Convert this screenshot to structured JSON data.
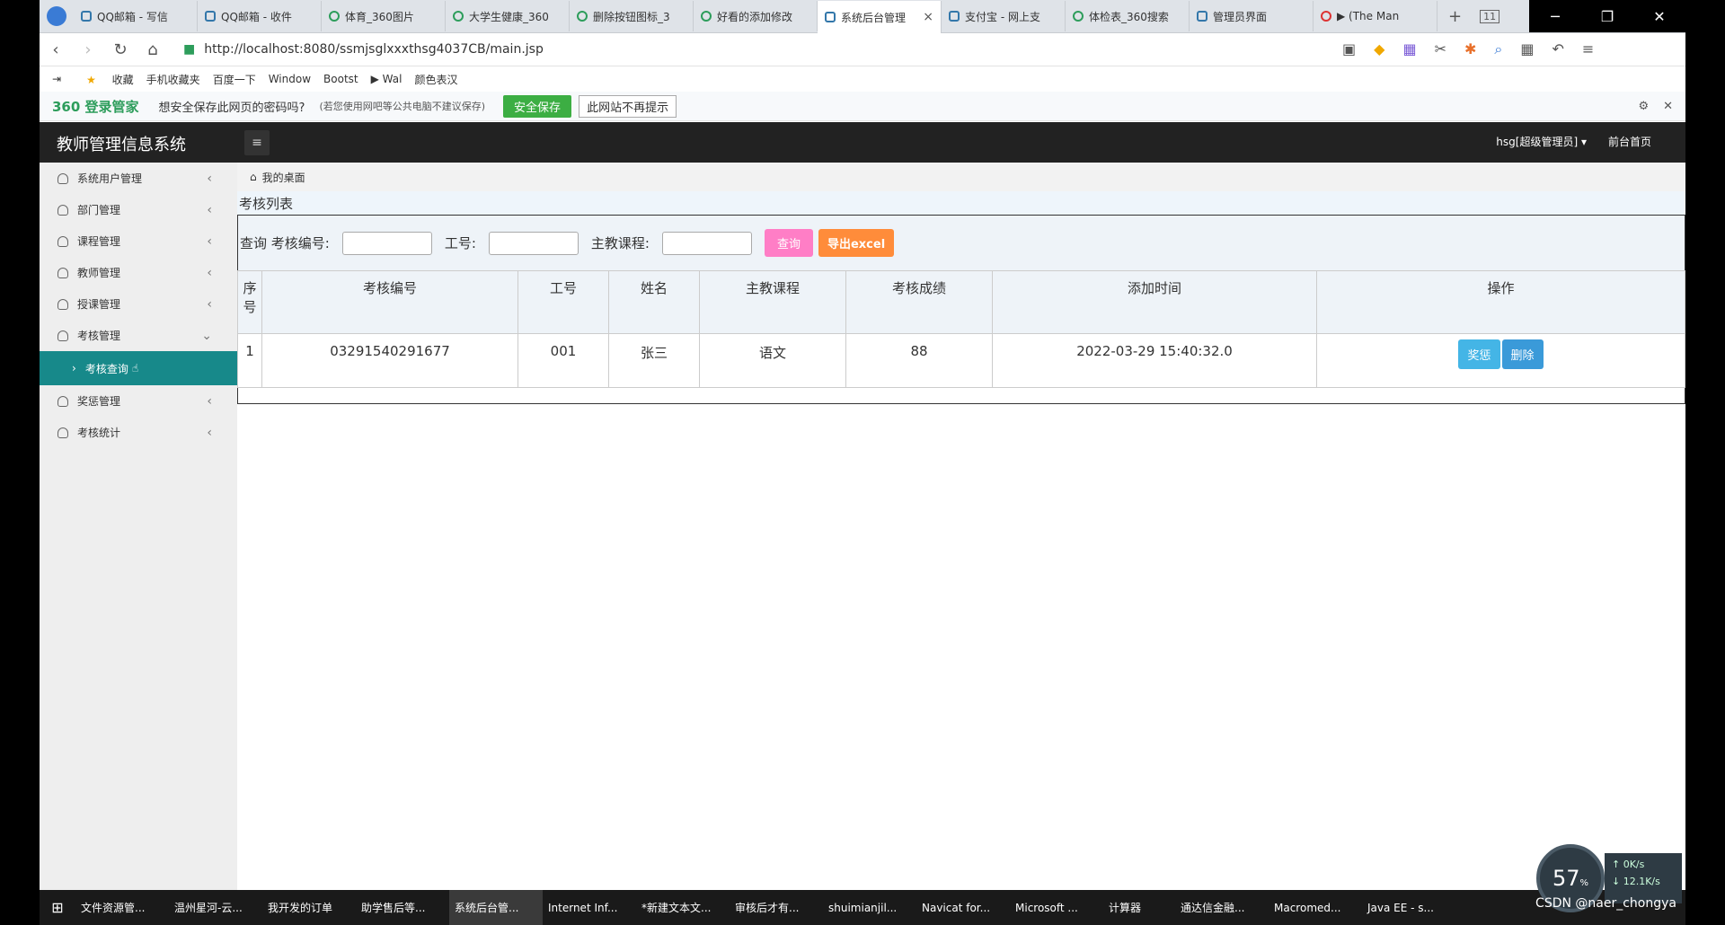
{
  "browser": {
    "tabs": [
      {
        "label": "QQ邮箱 - 写信",
        "active": false
      },
      {
        "label": "QQ邮箱 - 收件",
        "active": false
      },
      {
        "label": "体育_360图片",
        "active": false
      },
      {
        "label": "大学生健康_360",
        "active": false
      },
      {
        "label": "删除按钮图标_3",
        "active": false
      },
      {
        "label": "好看的添加修改",
        "active": false
      },
      {
        "label": "系统后台管理",
        "active": true
      },
      {
        "label": "支付宝 - 网上支",
        "active": false
      },
      {
        "label": "体检表_360搜索",
        "active": false
      },
      {
        "label": "管理员界面",
        "active": false
      },
      {
        "label": "▶ (The Man",
        "active": false
      }
    ],
    "tab_count_badge": "11",
    "url": "http://localhost:8080/ssmjsglxxxthsg4037CB/main.jsp",
    "bookmarks": [
      "收藏",
      "手机收藏夹",
      "百度一下",
      "Window",
      "Bootst",
      "▶ Wal",
      "颜色表汉"
    ],
    "pw_bar": {
      "brand": "360 登录管家",
      "question": "想安全保存此网页的密码吗?",
      "note": "(若您使用网吧等公共电脑不建议保存)",
      "save_button": "安全保存",
      "never_button": "此网站不再提示"
    }
  },
  "app": {
    "title": "教师管理信息系统",
    "user": "hsg[超级管理员]",
    "front_link": "前台首页"
  },
  "sidebar": {
    "items": [
      {
        "label": "系统用户管理",
        "chevron": "‹"
      },
      {
        "label": "部门管理",
        "chevron": "‹"
      },
      {
        "label": "课程管理",
        "chevron": "‹"
      },
      {
        "label": "教师管理",
        "chevron": "‹"
      },
      {
        "label": "授课管理",
        "chevron": "‹"
      },
      {
        "label": "考核管理",
        "chevron": "⌄"
      },
      {
        "label": "奖惩管理",
        "chevron": "‹"
      },
      {
        "label": "考核统计",
        "chevron": "‹"
      }
    ],
    "submenu_active": "考核查询"
  },
  "main": {
    "breadcrumb": "我的桌面",
    "list_title": "考核列表",
    "search": {
      "label_prefix": "查询 考核编号:",
      "label_id": "工号:",
      "label_course": "主教课程:",
      "query_button": "查询",
      "export_button": "导出excel"
    },
    "table": {
      "headers": [
        "序号",
        "考核编号",
        "工号",
        "姓名",
        "主教课程",
        "考核成绩",
        "添加时间",
        "操作"
      ],
      "rows": [
        {
          "index": "1",
          "code": "03291540291677",
          "emp_id": "001",
          "name": "张三",
          "course": "语文",
          "score": "88",
          "added": "2022-03-29 15:40:32.0"
        }
      ],
      "reward_button": "奖惩",
      "delete_button": "删除"
    }
  },
  "taskbar": {
    "items": [
      "文件资源管...",
      "温州星河-云...",
      "我开发的订单",
      "助学售后等...",
      "系统后台管...",
      "Internet Inf...",
      "*新建文本文...",
      "审核后才有...",
      "shuimianjil...",
      "Navicat for...",
      "Microsoft ...",
      "计算器",
      "通达信金融...",
      "Macromed...",
      "Java EE - s..."
    ],
    "gauge": "57",
    "gauge_unit": "%",
    "net_up": "0K/s",
    "net_down": "12.1K/s",
    "watermark": "CSDN @naer_chongya"
  },
  "colors": {
    "header_bg": "#222222",
    "sidebar_active": "#17898a",
    "query_btn": "#ff7ec6",
    "export_btn": "#ff8c3a",
    "reward_btn": "#44b5e6",
    "delete_btn": "#3a9ad9"
  }
}
